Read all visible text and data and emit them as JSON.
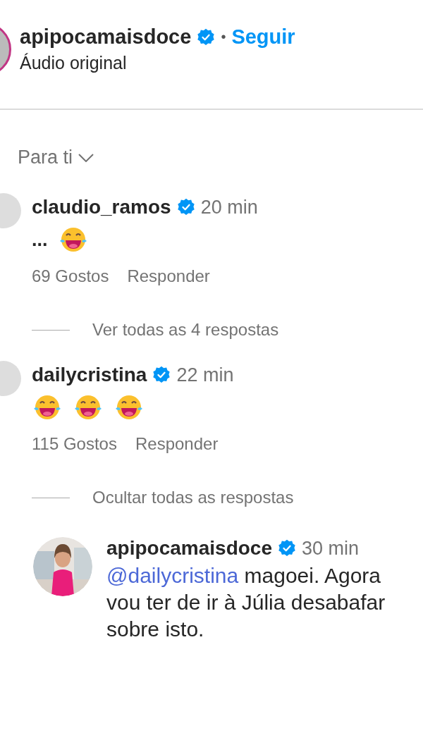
{
  "header": {
    "username": "apipocamaisdoce",
    "verified": true,
    "separator": "•",
    "follow": "Seguir",
    "subtitle": "Áudio original"
  },
  "sort": {
    "label": "Para ti"
  },
  "comments": [
    {
      "username": "claudio_ramos",
      "verified": true,
      "time": "20 min",
      "text": "...",
      "emojis": [
        {
          "kind": "laugh"
        }
      ],
      "likes": "69 Gostos",
      "reply": "Responder",
      "thread": "Ver todas as 4 respostas"
    },
    {
      "username": "dailycristina",
      "verified": true,
      "time": "22 min",
      "emojis": [
        {
          "kind": "laugh"
        },
        {
          "kind": "laugh"
        },
        {
          "kind": "laugh"
        }
      ],
      "likes": "115 Gostos",
      "reply": "Responder",
      "thread": "Ocultar todas as respostas",
      "replies": [
        {
          "username": "apipocamaisdoce",
          "verified": true,
          "time": "30 min",
          "mention": "@dailycristina",
          "text": "magoei. Agora vou ter de ir à Júlia desabafar sobre isto."
        }
      ]
    }
  ]
}
